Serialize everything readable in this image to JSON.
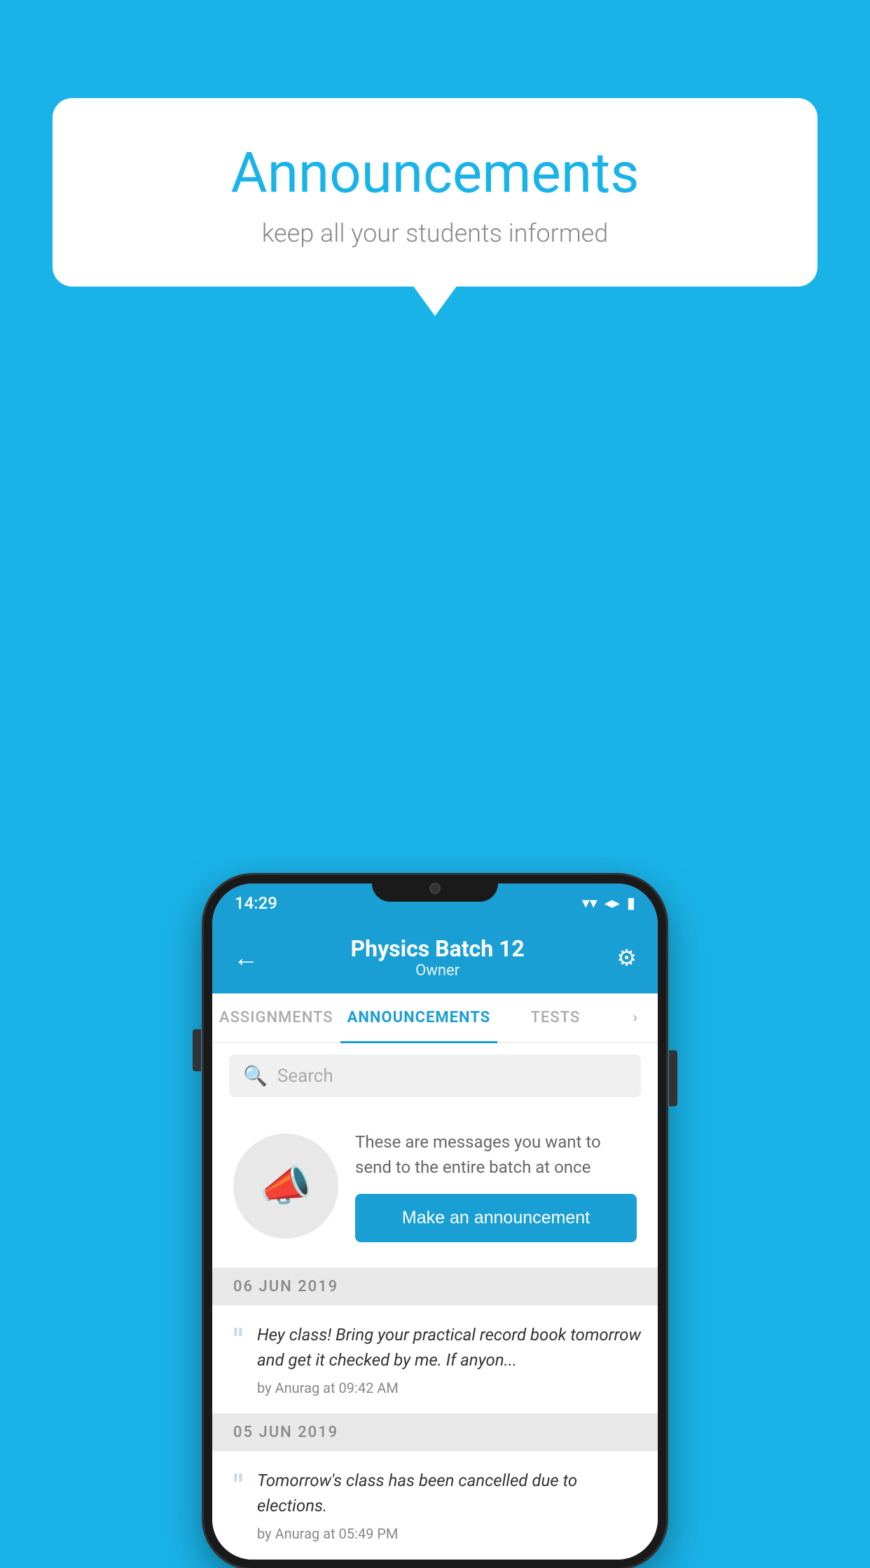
{
  "background": {
    "color": "#1ab3e8"
  },
  "speech_bubble": {
    "title": "Announcements",
    "subtitle": "keep all your students informed"
  },
  "status_bar": {
    "time": "14:29",
    "wifi": "▼",
    "signal": "▲",
    "battery": "▮"
  },
  "header": {
    "back_label": "←",
    "title": "Physics Batch 12",
    "subtitle": "Owner",
    "gear_label": "⚙"
  },
  "tabs": [
    {
      "label": "ASSIGNMENTS",
      "active": false
    },
    {
      "label": "ANNOUNCEMENTS",
      "active": true
    },
    {
      "label": "TESTS",
      "active": false
    },
    {
      "label": "›",
      "active": false
    }
  ],
  "search": {
    "placeholder": "Search"
  },
  "promo": {
    "description": "These are messages you want to send to the entire batch at once",
    "button_label": "Make an announcement"
  },
  "announcements": [
    {
      "date": "06  JUN  2019",
      "text": "Hey class! Bring your practical record book tomorrow and get it checked by me. If anyon...",
      "meta": "by Anurag at 09:42 AM"
    },
    {
      "date": "05  JUN  2019",
      "text": "Tomorrow's class has been cancelled due to elections.",
      "meta": "by Anurag at 05:49 PM"
    }
  ]
}
